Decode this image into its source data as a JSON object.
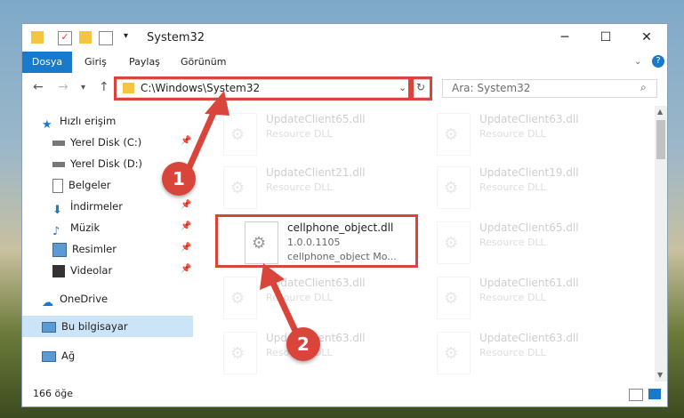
{
  "window": {
    "title": "System32"
  },
  "ribbon": {
    "tabs": [
      "Dosya",
      "Giriş",
      "Paylaş",
      "Görünüm"
    ]
  },
  "address": {
    "path": "C:\\Windows\\System32",
    "search_placeholder": "Ara: System32"
  },
  "sidebar": {
    "items": [
      {
        "label": "Hızlı erişim",
        "icon": "star-icon"
      },
      {
        "label": "Yerel Disk (C:)",
        "icon": "drive-icon"
      },
      {
        "label": "Yerel Disk (D:)",
        "icon": "drive-icon"
      },
      {
        "label": "Belgeler",
        "icon": "documents-icon"
      },
      {
        "label": "İndirmeler",
        "icon": "download-icon"
      },
      {
        "label": "Müzik",
        "icon": "music-icon"
      },
      {
        "label": "Resimler",
        "icon": "pictures-icon"
      },
      {
        "label": "Videolar",
        "icon": "video-icon"
      },
      {
        "label": "OneDrive",
        "icon": "cloud-icon"
      },
      {
        "label": "Bu bilgisayar",
        "icon": "computer-icon"
      },
      {
        "label": "Ağ",
        "icon": "network-icon"
      }
    ]
  },
  "files": [
    {
      "name": "UpdateClient65.dll",
      "desc": "Resource DLL"
    },
    {
      "name": "UpdateClient63.dll",
      "desc": "Resource DLL"
    },
    {
      "name": "UpdateClient21.dll",
      "desc": "Resource DLL"
    },
    {
      "name": "UpdateClient19.dll",
      "desc": "Resource DLL"
    },
    {
      "name": "cellphone_object.dll",
      "version": "1.0.0.1105",
      "desc": "cellphone_object Mo..."
    },
    {
      "name": "UpdateClient65.dll",
      "desc": "Resource DLL"
    },
    {
      "name": "UpdateClient63.dll",
      "desc": "Resource DLL"
    },
    {
      "name": "UpdateClient61.dll",
      "desc": "Resource DLL"
    },
    {
      "name": "UpdateClient63.dll",
      "desc": "Resource DLL"
    },
    {
      "name": "UpdateClient63.dll",
      "desc": "Resource DLL"
    }
  ],
  "status": {
    "count": "166 öğe"
  },
  "annotations": {
    "step1": "1",
    "step2": "2"
  },
  "colors": {
    "accent": "#1979ca",
    "highlight": "#d9453a",
    "selected": "#cce4f7"
  }
}
